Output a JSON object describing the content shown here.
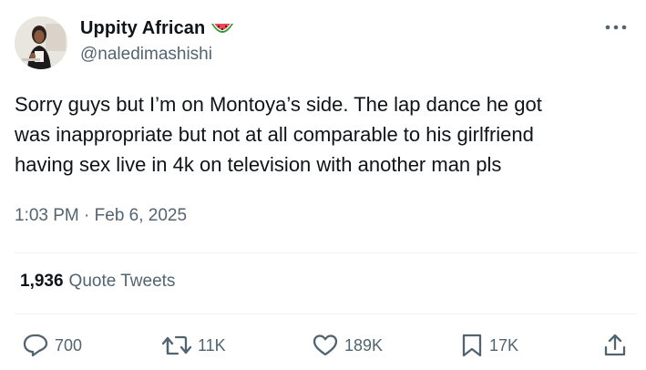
{
  "author": {
    "display_name": "Uppity African",
    "handle": "@naledimashishi",
    "name_emoji": "watermelon-icon"
  },
  "tweet": {
    "text": "Sorry guys but I’m on Montoya’s side. The lap dance he got\nwas inappropriate but not at all comparable to his girlfriend\nhaving sex live in 4k on television with another man pls",
    "time": "1:03 PM",
    "separator": " · ",
    "date": "Feb 6, 2025"
  },
  "quotes": {
    "count": "1,936",
    "label": "Quote Tweets"
  },
  "actions": {
    "replies": "700",
    "retweets": "11K",
    "likes": "189K",
    "bookmarks": "17K"
  },
  "colors": {
    "primary_text": "#0f1419",
    "secondary_text": "#536471",
    "divider": "#eff3f4",
    "watermelon_red": "#e8485a",
    "watermelon_green": "#3a9a3a"
  }
}
